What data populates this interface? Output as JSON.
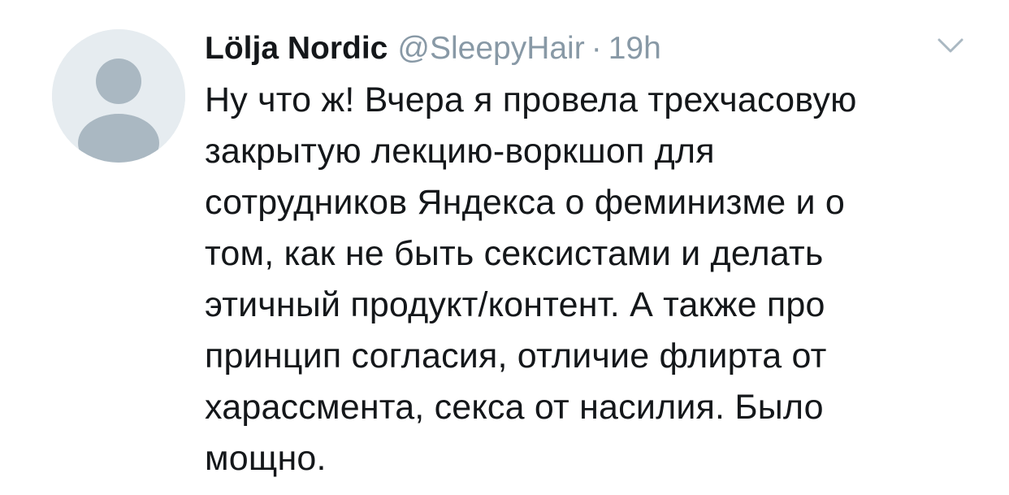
{
  "tweet": {
    "author": {
      "display_name": "Lölja Nordic",
      "handle": "@SleepyHair",
      "separator": "·",
      "time": "19h",
      "avatar_icon": "avatar-placeholder"
    },
    "menu_icon": "chevron-down-icon",
    "text_lines": [
      "Ну что ж! Вчера я провела трехчасовую",
      "закрытую лекцию-воркшоп для",
      "сотрудников Яндекса о феминизме и о",
      "том, как не быть сексистами и делать",
      "этичный продукт/контент. А также про",
      "принцип согласия, отличие флирта от",
      "харассмента, секса от насилия. Было",
      "мощно."
    ],
    "colors": {
      "text": "#14171a",
      "secondary": "#8899a6",
      "caret": "#aab8c2"
    }
  }
}
